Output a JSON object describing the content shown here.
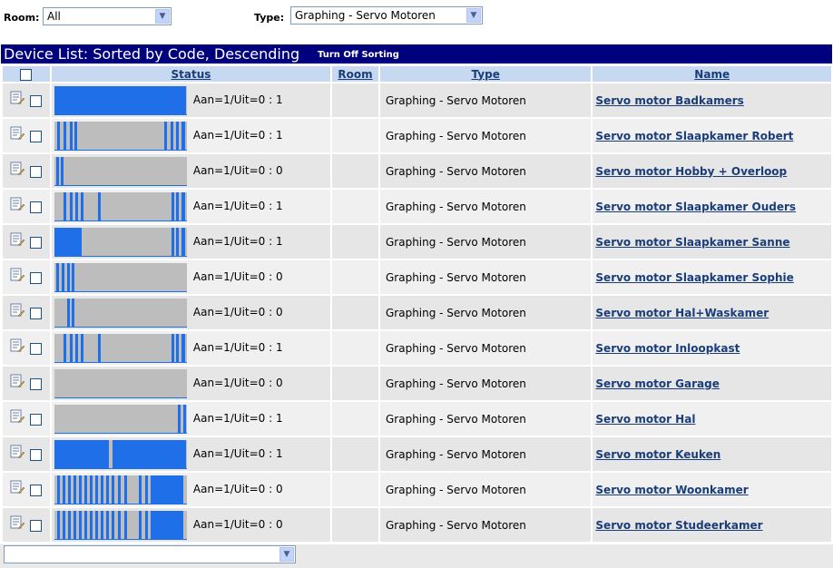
{
  "filters": {
    "room_label": "Room:",
    "room_value": "All",
    "type_label": "Type:",
    "type_value": "Graphing - Servo Motoren"
  },
  "list": {
    "title": "Device List: Sorted by Code, Descending",
    "toggle_sort": "Turn Off Sorting"
  },
  "headers": {
    "status": "Status",
    "room": "Room",
    "type": "Type",
    "name": "Name"
  },
  "colors": {
    "title_bar": "#00007f",
    "header_bg": "#c6d9f1",
    "bar_fill": "#1f6fe8",
    "bar_bg": "#bdbdbd",
    "link": "#1a3d7a"
  },
  "rows": [
    {
      "status": "Aan=1/Uit=0 : 1",
      "room": "",
      "type": "Graphing - Servo Motoren",
      "name": "Servo motor Badkamers"
    },
    {
      "status": "Aan=1/Uit=0 : 1",
      "room": "",
      "type": "Graphing - Servo Motoren",
      "name": "Servo motor Slaapkamer Robert"
    },
    {
      "status": "Aan=1/Uit=0 : 0",
      "room": "",
      "type": "Graphing - Servo Motoren",
      "name": "Servo motor Hobby + Overloop"
    },
    {
      "status": "Aan=1/Uit=0 : 1",
      "room": "",
      "type": "Graphing - Servo Motoren",
      "name": "Servo motor Slaapkamer Ouders"
    },
    {
      "status": "Aan=1/Uit=0 : 1",
      "room": "",
      "type": "Graphing - Servo Motoren",
      "name": "Servo motor Slaapkamer Sanne"
    },
    {
      "status": "Aan=1/Uit=0 : 0",
      "room": "",
      "type": "Graphing - Servo Motoren",
      "name": "Servo motor Slaapkamer Sophie"
    },
    {
      "status": "Aan=1/Uit=0 : 0",
      "room": "",
      "type": "Graphing - Servo Motoren",
      "name": "Servo motor Hal+Waskamer"
    },
    {
      "status": "Aan=1/Uit=0 : 1",
      "room": "",
      "type": "Graphing - Servo Motoren",
      "name": "Servo motor Inloopkast"
    },
    {
      "status": "Aan=1/Uit=0 : 0",
      "room": "",
      "type": "Graphing - Servo Motoren",
      "name": "Servo motor Garage"
    },
    {
      "status": "Aan=1/Uit=0 : 1",
      "room": "",
      "type": "Graphing - Servo Motoren",
      "name": "Servo motor Hal"
    },
    {
      "status": "Aan=1/Uit=0 : 1",
      "room": "",
      "type": "Graphing - Servo Motoren",
      "name": "Servo motor Keuken"
    },
    {
      "status": "Aan=1/Uit=0 : 0",
      "room": "",
      "type": "Graphing - Servo Motoren",
      "name": "Servo motor Woonkamer"
    },
    {
      "status": "Aan=1/Uit=0 : 0",
      "room": "",
      "type": "Graphing - Servo Motoren",
      "name": "Servo motor Studeerkamer"
    }
  ],
  "bottom_select": {
    "value": ""
  }
}
